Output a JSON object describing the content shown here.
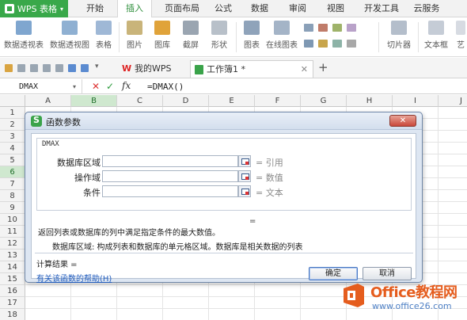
{
  "app": {
    "name": "WPS 表格"
  },
  "menu": {
    "items": [
      "开始",
      "插入",
      "页面布局",
      "公式",
      "数据",
      "审阅",
      "视图",
      "开发工具",
      "云服务"
    ],
    "active": "插入"
  },
  "ribbon": {
    "buttons": [
      "数据透视表",
      "数据透视图",
      "表格",
      "图片",
      "图库",
      "截屏",
      "形状",
      "图表",
      "在线图表",
      "切片器",
      "文本框"
    ],
    "overflow": "艺"
  },
  "doc_tabs": {
    "tabs": [
      {
        "label": "我的WPS"
      },
      {
        "label": "工作簿1 *"
      }
    ],
    "add_label": "+"
  },
  "formula_bar": {
    "name_box": "DMAX",
    "cancel_symbol": "✕",
    "confirm_symbol": "✓",
    "fx_label": "fx",
    "formula": "=DMAX()"
  },
  "grid": {
    "columns": [
      "A",
      "B",
      "C",
      "D",
      "E",
      "F",
      "G",
      "H",
      "I",
      "J"
    ],
    "rows": [
      "1",
      "2",
      "3",
      "4",
      "5",
      "6",
      "7",
      "8",
      "9",
      "10",
      "11",
      "12",
      "13",
      "14",
      "15",
      "16",
      "17",
      "18"
    ],
    "selected_column": "B",
    "selected_row": "6"
  },
  "dialog": {
    "title": "函数参数",
    "close_label": "✕",
    "function_name": "DMAX",
    "args": [
      {
        "label": "数据库区域",
        "value": "= 引用"
      },
      {
        "label": "操作域",
        "value": "= 数值"
      },
      {
        "label": "条件",
        "value": "= 文本"
      }
    ],
    "equals": "=",
    "description": "返回列表或数据库的列中满足指定条件的最大数值。",
    "arg_description": "数据库区域:  构成列表和数据库的单元格区域。数据库是相关数据的列表",
    "result": "计算结果 =",
    "help_link": "有关该函数的帮助(H)",
    "ok_label": "确定",
    "cancel_label": "取消"
  },
  "watermark": {
    "brand": "Office教程网",
    "url": "www.office26.com"
  },
  "colors": {
    "wps_green": "#39a84a",
    "selection_header": "#cfe8cf",
    "arrow_red": "#e0382d",
    "link_blue": "#1f5bbd",
    "watermark_orange": "#e55d1e"
  }
}
